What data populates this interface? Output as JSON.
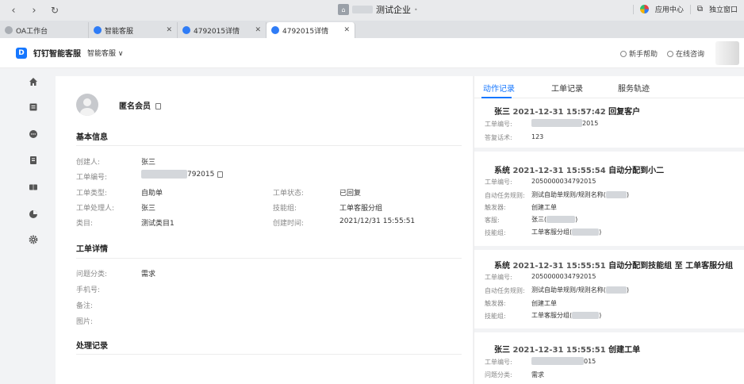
{
  "titlebar": {
    "org_name": "测试企业",
    "app_center": "应用中心",
    "standalone": "独立窗口"
  },
  "tabs": [
    {
      "label": "OA工作台"
    },
    {
      "label": "智能客服"
    },
    {
      "label": "4792015详情"
    },
    {
      "label": "4792015详情"
    }
  ],
  "app": {
    "title": "钉钉智能客服",
    "sub": "智能客服 ∨",
    "help": "新手帮助",
    "consult": "在线咨询"
  },
  "member": {
    "name": "匿名会员"
  },
  "basic": {
    "title": "基本信息",
    "creator_label": "创建人:",
    "creator": "张三",
    "order_no_label": "工单编号:",
    "order_no_suffix": "792015",
    "type_label": "工单类型:",
    "type": "自助单",
    "status_label": "工单状态:",
    "status": "已回复",
    "handler_label": "工单处理人:",
    "handler": "张三",
    "group_label": "技能组:",
    "group": "工单客服分组",
    "category_label": "类目:",
    "category": "测试类目1",
    "created_label": "创建时间:",
    "created": "2021/12/31 15:55:51"
  },
  "detail": {
    "title": "工单详情",
    "problem_label": "问题分类:",
    "problem": "需求",
    "phone_label": "手机号:",
    "note_label": "备注:",
    "image_label": "图片:"
  },
  "process": {
    "title": "处理记录"
  },
  "right_tabs": [
    {
      "label": "动作记录"
    },
    {
      "label": "工单记录"
    },
    {
      "label": "服务轨迹"
    }
  ],
  "records": [
    {
      "actor": "张三",
      "time": "2021-12-31 15:57:42",
      "action": "回复客户",
      "rows": [
        {
          "label": "工单编号:",
          "value": "2015"
        },
        {
          "label": "答复话术:",
          "value": "123"
        }
      ]
    },
    {
      "actor": "系统",
      "time": "2021-12-31 15:55:54",
      "action": "自动分配到小二",
      "rows": [
        {
          "label": "工单编号:",
          "value": "2050000034792015"
        },
        {
          "label": "自动任务规则:",
          "value": "测试自助单规则/规则名称(",
          "tail": ")"
        },
        {
          "label": "触发器:",
          "value": "创建工单"
        },
        {
          "label": "客服:",
          "value": "张三(",
          "tail": ")"
        },
        {
          "label": "技能组:",
          "value": "工单客服分组(",
          "tail": ")"
        }
      ]
    },
    {
      "actor": "系统",
      "time": "2021-12-31 15:55:51",
      "action": "自动分配到技能组 至 工单客服分组",
      "rows": [
        {
          "label": "工单编号:",
          "value": "2050000034792015"
        },
        {
          "label": "自动任务规则:",
          "value": "测试自助单规则/规则名称(",
          "tail": ")"
        },
        {
          "label": "触发器:",
          "value": "创建工单"
        },
        {
          "label": "技能组:",
          "value": "工单客服分组(",
          "tail": ")"
        }
      ]
    },
    {
      "actor": "张三",
      "time": "2021-12-31 15:55:51",
      "action": "创建工单",
      "rows": [
        {
          "label": "工单编号:",
          "value": "015"
        },
        {
          "label": "问题分类:",
          "value": "需求"
        }
      ]
    }
  ]
}
